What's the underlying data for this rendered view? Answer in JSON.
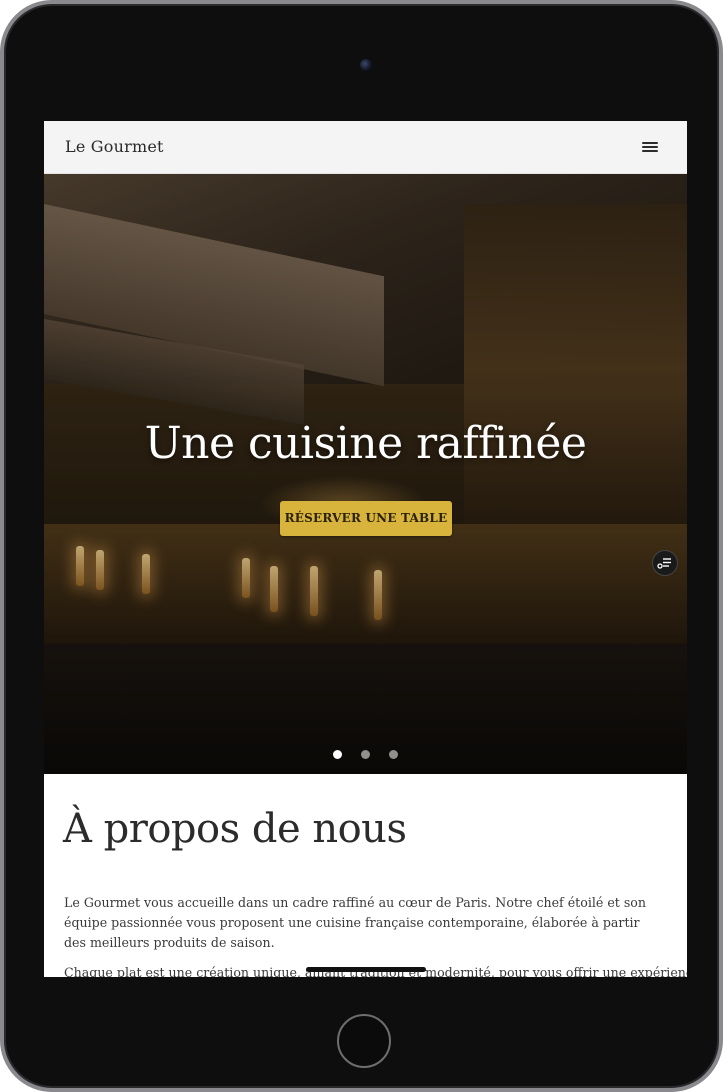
{
  "navbar": {
    "brand": "Le Gourmet",
    "menu_icon": "hamburger-menu-icon"
  },
  "hero": {
    "title": "Une cuisine raffinée",
    "button_label": "RÉSERVER UNE TABLE",
    "button_color": "#d9b43c",
    "float_icon": "filter-menu-icon",
    "slides": 3,
    "active_slide": 1
  },
  "about": {
    "title": "À propos de nous",
    "paragraph1": "Le Gourmet vous accueille dans un cadre raffiné au cœur de Paris. Notre chef étoilé et son équipe passionnée vous proposent une cuisine française contemporaine, élaborée à partir des meilleurs produits de saison.",
    "paragraph2": "Chaque plat est une création unique, alliant tradition et modernité, pour vous offrir une expérience"
  },
  "device": {
    "camera_icon": "front-camera-icon",
    "home_button_icon": "home-button-icon"
  }
}
